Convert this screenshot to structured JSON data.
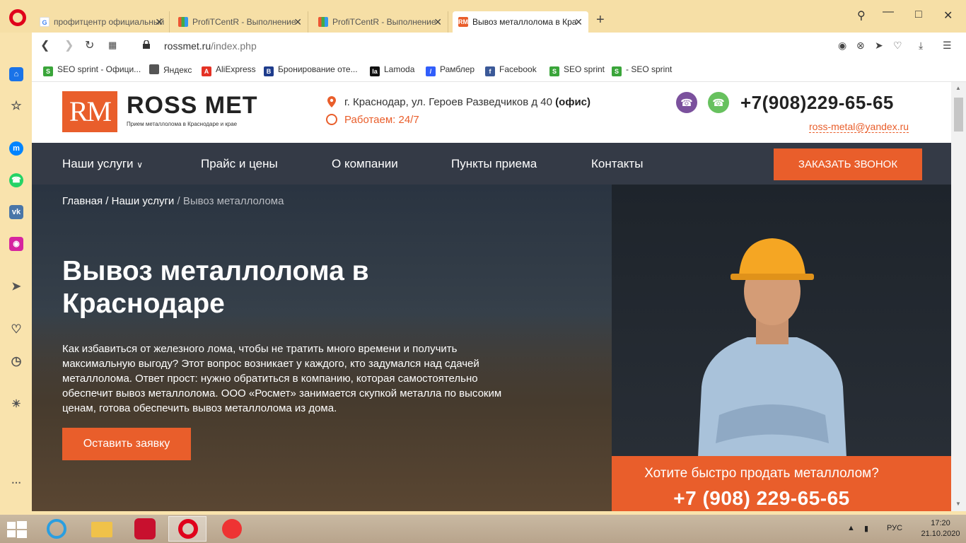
{
  "browser": {
    "tabs": [
      {
        "label": "профитцентр официальный",
        "favicon": "G"
      },
      {
        "label": "ProfiTCentR - Выполнение",
        "favicon": "chart"
      },
      {
        "label": "ProfiTCentR - Выполнение",
        "favicon": "chart"
      },
      {
        "label": "Вывоз металлолома в Кра",
        "favicon": "RM"
      }
    ],
    "url_host": "rossmet.ru",
    "url_path": "/index.php",
    "bookmarks": [
      {
        "label": "SEO sprint - Офици..."
      },
      {
        "label": "Яндекс"
      },
      {
        "label": "AliExpress"
      },
      {
        "label": "Бронирование оте..."
      },
      {
        "label": "Lamoda"
      },
      {
        "label": "Рамблер"
      },
      {
        "label": "Facebook"
      },
      {
        "label": "SEO sprint"
      },
      {
        "label": "- SEO sprint"
      }
    ]
  },
  "site": {
    "logo_mark": "RM",
    "logo_name": "ROSS MET",
    "logo_sub": "Прием металлолома в Краснодаре и крае",
    "address": "г. Краснодар, ул. Героев Разведчиков д 40",
    "address_note": "(офис)",
    "hours": "Работаем: 24/7",
    "phone": "+7(908)229-65-65",
    "email": "ross-metal@yandex.ru",
    "menu": [
      "Наши услуги",
      "Прайс и цены",
      "О компании",
      "Пункты приема",
      "Контакты"
    ],
    "callback": "ЗАКАЗАТЬ ЗВОНОК",
    "breadcrumb": {
      "home": "Главная",
      "sep": "/",
      "section": "Наши услуги",
      "current": "Вывоз металлолома"
    },
    "hero_title": "Вывоз металлолома в Краснодаре",
    "hero_text": "Как избавиться от железного лома, чтобы не тратить много времени и получить максимальную выгоду? Этот вопрос возникает у каждого, кто задумался над сдачей металлолома. Ответ прост: нужно обратиться в компанию, которая самостоятельно обеспечит вывоз металлолома. ООО «Росмет» занимается скупкой металла по высоким ценам, готова обеспечить вывоз металлолома из дома.",
    "hero_button": "Оставить заявку",
    "promo_question": "Хотите быстро продать металлолом?",
    "promo_phone": "+7 (908) 229-65-65"
  },
  "taskbar": {
    "lang": "РУС",
    "time": "17:20",
    "date": "21.10.2020"
  },
  "colors": {
    "accent": "#e95e2b",
    "menu_bg": "#343a46",
    "chrome_bg": "#f9e3ad"
  }
}
